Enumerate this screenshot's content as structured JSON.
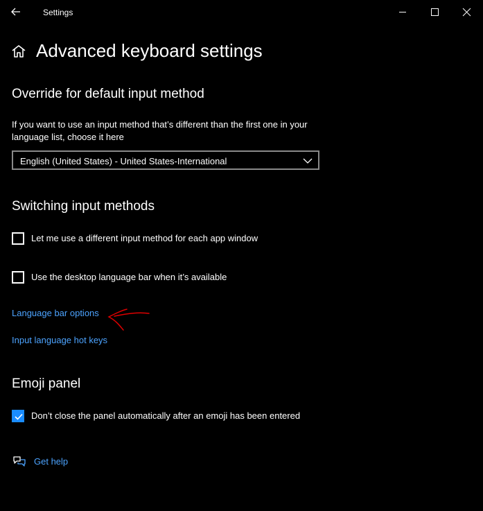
{
  "window": {
    "title": "Settings",
    "back_icon": "back-arrow-icon",
    "minimize_icon": "minimize-icon",
    "maximize_icon": "maximize-icon",
    "close_icon": "close-icon"
  },
  "page": {
    "home_icon": "home-icon",
    "title": "Advanced keyboard settings"
  },
  "override": {
    "heading": "Override for default input method",
    "description": "If you want to use an input method that’s different than the first one in your language list, choose it here",
    "selected_value": "English (United States) - United States-International",
    "chevron_icon": "chevron-down-icon"
  },
  "switching": {
    "heading": "Switching input methods",
    "checkbox1": {
      "label": "Let me use a different input method for each app window",
      "checked": false
    },
    "checkbox2": {
      "label": "Use the desktop language bar when it’s available",
      "checked": false
    },
    "link1": "Language bar options",
    "link2": "Input language hot keys"
  },
  "emoji": {
    "heading": "Emoji panel",
    "checkbox": {
      "label": "Don’t close the panel automatically after an emoji has been entered",
      "checked": true
    }
  },
  "help": {
    "icon": "help-chat-icon",
    "label": "Get help"
  },
  "colors": {
    "background": "#000000",
    "text": "#ffffff",
    "link": "#4ca3ff",
    "accent": "#1a8cff",
    "annotation": "#e00000"
  }
}
